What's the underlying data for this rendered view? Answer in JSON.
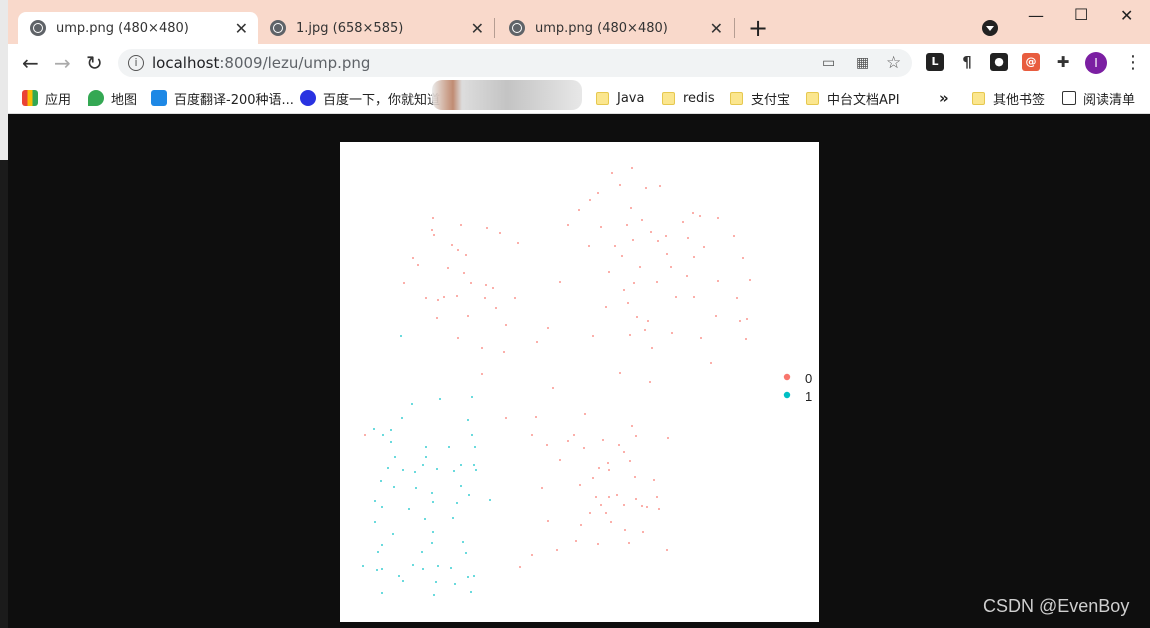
{
  "tabs": [
    {
      "title": "ump.png (480×480)",
      "active": true
    },
    {
      "title": "1.jpg (658×585)",
      "active": false
    },
    {
      "title": "ump.png (480×480)",
      "active": false
    }
  ],
  "address": {
    "host": "localhost",
    "path": ":8009/lezu/ump.png"
  },
  "avatar_letter": "I",
  "bookmarks": [
    {
      "label": "应用",
      "icon": "apps-grid-icon"
    },
    {
      "label": "地图",
      "icon": "maps-pin-icon"
    },
    {
      "label": "百度翻译-200种语...",
      "icon": "translate-icon"
    },
    {
      "label": "百度一下，你就知道",
      "icon": "baidu-paw-icon"
    },
    {
      "label": "Java",
      "icon": "folder-icon"
    },
    {
      "label": "redis",
      "icon": "folder-icon"
    },
    {
      "label": "支付宝",
      "icon": "folder-icon"
    },
    {
      "label": "中台文档API",
      "icon": "folder-icon"
    },
    {
      "label": "其他书签",
      "icon": "folder-icon"
    },
    {
      "label": "阅读清单",
      "icon": "reading-list-icon"
    }
  ],
  "overflow_label": "»",
  "watermark": "CSDN @EvenBoy",
  "colors": {
    "class0": "#f8766d",
    "class1": "#00bfc4",
    "tabstrip": "#f9d9cb"
  },
  "chart_data": {
    "type": "scatter",
    "title": "",
    "xlabel": "",
    "ylabel": "",
    "legend": {
      "entries": [
        "0",
        "1"
      ],
      "placement": "right"
    },
    "series": [
      {
        "name": "0",
        "color": "#f8766d",
        "points": [
          [
            433,
            218
          ],
          [
            432,
            230
          ],
          [
            461,
            225
          ],
          [
            434,
            235
          ],
          [
            487,
            228
          ],
          [
            500,
            233
          ],
          [
            518,
            243
          ],
          [
            452,
            245
          ],
          [
            458,
            250
          ],
          [
            466,
            255
          ],
          [
            413,
            258
          ],
          [
            418,
            265
          ],
          [
            448,
            268
          ],
          [
            464,
            273
          ],
          [
            471,
            283
          ],
          [
            486,
            285
          ],
          [
            493,
            288
          ],
          [
            404,
            283
          ],
          [
            485,
            298
          ],
          [
            426,
            298
          ],
          [
            438,
            300
          ],
          [
            444,
            297
          ],
          [
            457,
            296
          ],
          [
            515,
            298
          ],
          [
            437,
            318
          ],
          [
            468,
            316
          ],
          [
            496,
            308
          ],
          [
            506,
            325
          ],
          [
            548,
            328
          ],
          [
            458,
            338
          ],
          [
            482,
            348
          ],
          [
            504,
            352
          ],
          [
            537,
            342
          ],
          [
            482,
            374
          ],
          [
            553,
            388
          ],
          [
            632,
            168
          ],
          [
            612,
            173
          ],
          [
            620,
            185
          ],
          [
            646,
            188
          ],
          [
            660,
            186
          ],
          [
            598,
            193
          ],
          [
            590,
            200
          ],
          [
            579,
            210
          ],
          [
            631,
            208
          ],
          [
            642,
            220
          ],
          [
            693,
            213
          ],
          [
            700,
            216
          ],
          [
            718,
            218
          ],
          [
            683,
            222
          ],
          [
            568,
            225
          ],
          [
            601,
            227
          ],
          [
            627,
            225
          ],
          [
            651,
            232
          ],
          [
            633,
            240
          ],
          [
            589,
            246
          ],
          [
            615,
            246
          ],
          [
            658,
            241
          ],
          [
            666,
            236
          ],
          [
            734,
            236
          ],
          [
            688,
            238
          ],
          [
            704,
            247
          ],
          [
            622,
            256
          ],
          [
            667,
            254
          ],
          [
            694,
            257
          ],
          [
            743,
            258
          ],
          [
            640,
            267
          ],
          [
            671,
            267
          ],
          [
            687,
            276
          ],
          [
            609,
            272
          ],
          [
            750,
            280
          ],
          [
            560,
            282
          ],
          [
            634,
            283
          ],
          [
            657,
            282
          ],
          [
            718,
            281
          ],
          [
            624,
            290
          ],
          [
            676,
            297
          ],
          [
            694,
            297
          ],
          [
            737,
            298
          ],
          [
            628,
            303
          ],
          [
            606,
            307
          ],
          [
            637,
            317
          ],
          [
            648,
            321
          ],
          [
            716,
            316
          ],
          [
            747,
            319
          ],
          [
            740,
            321
          ],
          [
            593,
            336
          ],
          [
            630,
            335
          ],
          [
            645,
            330
          ],
          [
            672,
            333
          ],
          [
            746,
            339
          ],
          [
            652,
            348
          ],
          [
            701,
            338
          ],
          [
            711,
            363
          ],
          [
            620,
            373
          ],
          [
            650,
            382
          ],
          [
            536,
            417
          ],
          [
            585,
            414
          ],
          [
            506,
            418
          ],
          [
            574,
            435
          ],
          [
            532,
            435
          ],
          [
            568,
            441
          ],
          [
            547,
            445
          ],
          [
            632,
            426
          ],
          [
            636,
            436
          ],
          [
            603,
            440
          ],
          [
            619,
            445
          ],
          [
            668,
            438
          ],
          [
            584,
            448
          ],
          [
            624,
            452
          ],
          [
            560,
            460
          ],
          [
            608,
            463
          ],
          [
            630,
            461
          ],
          [
            599,
            468
          ],
          [
            609,
            470
          ],
          [
            593,
            478
          ],
          [
            635,
            477
          ],
          [
            654,
            480
          ],
          [
            580,
            485
          ],
          [
            542,
            488
          ],
          [
            596,
            497
          ],
          [
            609,
            497
          ],
          [
            617,
            495
          ],
          [
            636,
            499
          ],
          [
            657,
            497
          ],
          [
            601,
            505
          ],
          [
            624,
            505
          ],
          [
            642,
            506
          ],
          [
            647,
            507
          ],
          [
            659,
            509
          ],
          [
            590,
            513
          ],
          [
            606,
            513
          ],
          [
            611,
            522
          ],
          [
            548,
            521
          ],
          [
            581,
            525
          ],
          [
            625,
            530
          ],
          [
            643,
            532
          ],
          [
            576,
            541
          ],
          [
            557,
            550
          ],
          [
            598,
            544
          ],
          [
            629,
            543
          ],
          [
            667,
            550
          ],
          [
            532,
            555
          ],
          [
            520,
            567
          ],
          [
            365,
            435
          ]
        ]
      },
      {
        "name": "1",
        "color": "#00bfc4",
        "points": [
          [
            401,
            336
          ],
          [
            440,
            399
          ],
          [
            472,
            397
          ],
          [
            412,
            404
          ],
          [
            402,
            418
          ],
          [
            468,
            420
          ],
          [
            391,
            430
          ],
          [
            374,
            429
          ],
          [
            383,
            435
          ],
          [
            472,
            435
          ],
          [
            391,
            442
          ],
          [
            426,
            447
          ],
          [
            449,
            447
          ],
          [
            475,
            447
          ],
          [
            395,
            457
          ],
          [
            426,
            457
          ],
          [
            423,
            465
          ],
          [
            461,
            465
          ],
          [
            474,
            465
          ],
          [
            437,
            469
          ],
          [
            454,
            471
          ],
          [
            476,
            470
          ],
          [
            388,
            468
          ],
          [
            403,
            470
          ],
          [
            415,
            472
          ],
          [
            381,
            481
          ],
          [
            394,
            487
          ],
          [
            461,
            486
          ],
          [
            416,
            488
          ],
          [
            432,
            493
          ],
          [
            469,
            495
          ],
          [
            490,
            500
          ],
          [
            375,
            501
          ],
          [
            433,
            502
          ],
          [
            457,
            503
          ],
          [
            409,
            509
          ],
          [
            382,
            507
          ],
          [
            425,
            519
          ],
          [
            453,
            518
          ],
          [
            375,
            522
          ],
          [
            433,
            532
          ],
          [
            393,
            534
          ],
          [
            382,
            545
          ],
          [
            432,
            543
          ],
          [
            463,
            542
          ],
          [
            378,
            552
          ],
          [
            422,
            552
          ],
          [
            466,
            553
          ],
          [
            413,
            565
          ],
          [
            438,
            566
          ],
          [
            423,
            569
          ],
          [
            451,
            568
          ],
          [
            363,
            566
          ],
          [
            377,
            570
          ],
          [
            382,
            569
          ],
          [
            399,
            576
          ],
          [
            468,
            577
          ],
          [
            474,
            576
          ],
          [
            403,
            581
          ],
          [
            436,
            582
          ],
          [
            455,
            584
          ],
          [
            382,
            593
          ],
          [
            434,
            595
          ],
          [
            471,
            592
          ]
        ]
      }
    ]
  }
}
